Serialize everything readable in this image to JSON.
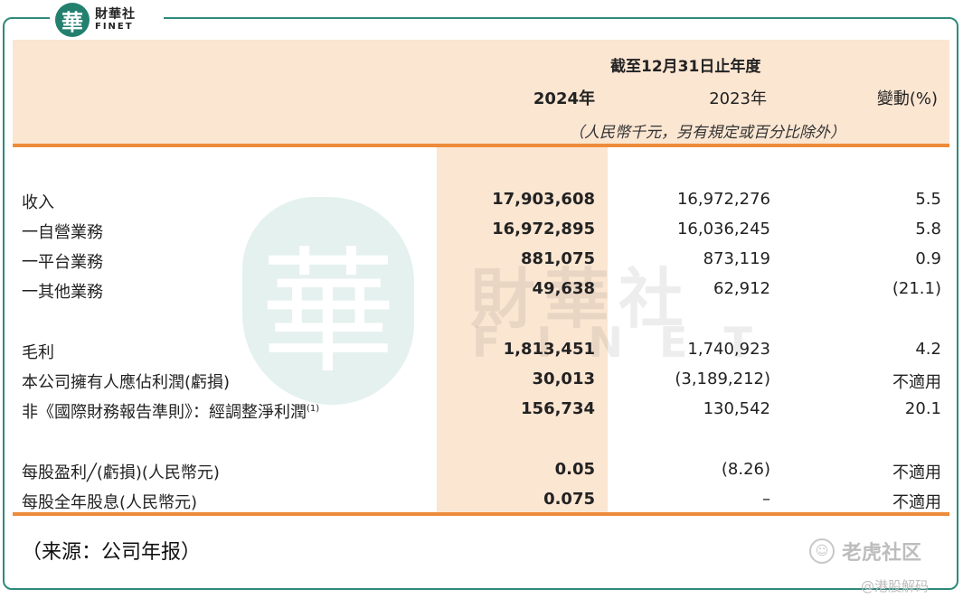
{
  "logo": {
    "seal": "華",
    "cn": "財華社",
    "en": "FINET"
  },
  "watermark": {
    "seal": "華",
    "cn": "財華社",
    "en": "FINET"
  },
  "header": {
    "span": "截至12月31日止年度",
    "col_2024": "2024年",
    "col_2023": "2023年",
    "col_change": "變動(%)",
    "unit_note": "（人民幣千元，另有規定或百分比除外）"
  },
  "rows": [
    {
      "label": "收入",
      "v2024": "17,903,608",
      "v2023": "16,972,276",
      "change": "5.5"
    },
    {
      "label": "一自營業務",
      "v2024": "16,972,895",
      "v2023": "16,036,245",
      "change": "5.8"
    },
    {
      "label": "一平台業務",
      "v2024": "881,075",
      "v2023": "873,119",
      "change": "0.9"
    },
    {
      "label": "一其他業務",
      "v2024": "49,638",
      "v2023": "62,912",
      "change": "(21.1)"
    },
    {
      "label": "毛利",
      "v2024": "1,813,451",
      "v2023": "1,740,923",
      "change": "4.2"
    },
    {
      "label": "本公司擁有人應佔利潤(虧損)",
      "v2024": "30,013",
      "v2023": "(3,189,212)",
      "change": "不適用"
    },
    {
      "label": "非《國際財務報告準則》：經調整淨利潤",
      "sup": "(1)",
      "v2024": "156,734",
      "v2023": "130,542",
      "change": "20.1"
    },
    {
      "label": "每股盈利╱(虧損)(人民幣元)",
      "v2024": "0.05",
      "v2023": "(8.26)",
      "change": "不適用"
    },
    {
      "label": "每股全年股息(人民幣元)",
      "v2024": "0.075",
      "v2023": "–",
      "change": "不適用"
    }
  ],
  "source": "（来源：公司年报）",
  "footer": {
    "brand": "老虎社区",
    "handle": "@港股解码"
  },
  "colors": {
    "band": "#fbe6d2",
    "rule": "#ee8b3a",
    "frame": "#2f8a7a"
  }
}
